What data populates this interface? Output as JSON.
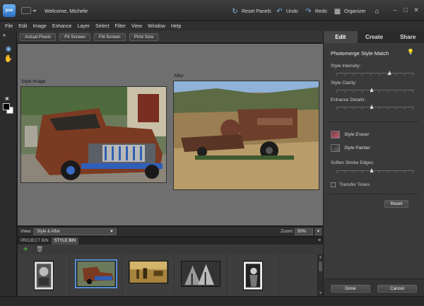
{
  "app": {
    "logo_text": "pse",
    "welcome": "Welcome, Michele"
  },
  "titlebar": {
    "reset_panels": "Reset Panels",
    "undo": "Undo",
    "redo": "Redo",
    "organizer": "Organizer"
  },
  "menu": [
    "File",
    "Edit",
    "Image",
    "Enhance",
    "Layer",
    "Select",
    "Filter",
    "View",
    "Window",
    "Help"
  ],
  "options_bar": {
    "buttons": [
      "Actual Pixels",
      "Fit Screen",
      "Fill Screen",
      "Print Size"
    ]
  },
  "canvas": {
    "style_image_label": "Style Image",
    "after_label": "After",
    "view_label": "View:",
    "view_value": "Style & After",
    "zoom_label": "Zoom:",
    "zoom_value": "50%"
  },
  "bin": {
    "tabs": [
      "PROJECT BIN",
      "STYLE BIN"
    ],
    "active_tab": "STYLE BIN",
    "thumbnail_count": 5,
    "selected_index": 1
  },
  "panel": {
    "tabs": [
      "Edit",
      "Create",
      "Share"
    ],
    "active_tab": "Edit",
    "title": "Photomerge Style Match",
    "sliders": [
      {
        "label": "Style Intensity:",
        "value": 0.68
      },
      {
        "label": "Style Clarity:",
        "value": 0.45
      },
      {
        "label": "Enhance Details:",
        "value": 0.45
      }
    ],
    "style_eraser": "Style Eraser",
    "style_painter": "Style Painter",
    "soften_label": "Soften Stroke Edges:",
    "soften_value": 0.45,
    "transfer_tones": "Transfer Tones",
    "transfer_tones_checked": false,
    "reset": "Reset",
    "done": "Done",
    "cancel": "Cancel"
  },
  "colors": {
    "accent": "#5a8fd8",
    "panel_bg": "#3a3a3a",
    "canvas_bg": "#6f6f6f"
  }
}
